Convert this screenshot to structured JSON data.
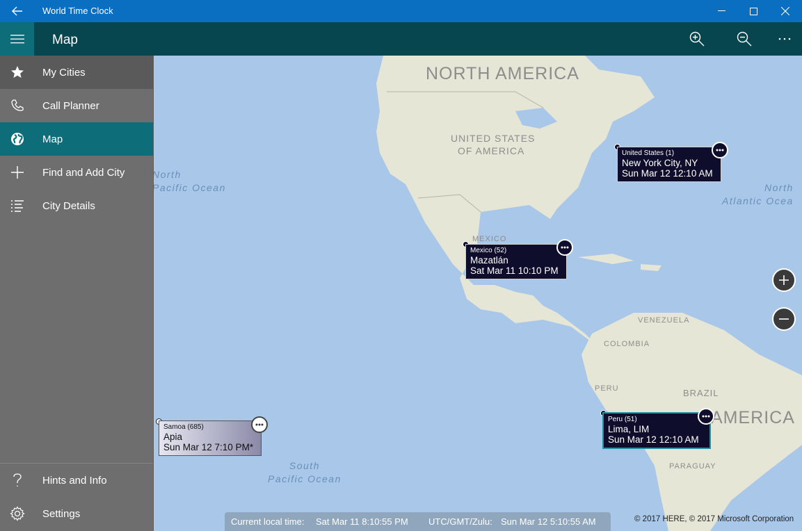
{
  "window": {
    "title": "World Time Clock"
  },
  "appbar": {
    "page_title": "Map"
  },
  "nav": {
    "items": [
      {
        "label": "My Cities",
        "icon": "star-icon"
      },
      {
        "label": "Call Planner",
        "icon": "phone-icon"
      },
      {
        "label": "Map",
        "icon": "globe-icon"
      },
      {
        "label": "Find and Add City",
        "icon": "plus-icon"
      },
      {
        "label": "City Details",
        "icon": "list-icon"
      }
    ],
    "bottom": [
      {
        "label": "Hints and Info",
        "icon": "question-icon"
      },
      {
        "label": "Settings",
        "icon": "gear-icon"
      }
    ],
    "selected": "Map"
  },
  "map": {
    "continents": [
      "NORTH AMERICA",
      "AMERICA"
    ],
    "countries": [
      "UNITED STATES",
      "OF AMERICA",
      "MEXICO",
      "VENEZUELA",
      "COLOMBIA",
      "PERU",
      "BRAZIL",
      "PARAGUAY"
    ],
    "oceans": {
      "north_pacific": [
        "North",
        "Pacific Ocean"
      ],
      "north_atlantic": [
        "North",
        "Atlantic Ocea"
      ],
      "south_pacific": [
        "South",
        "Pacific Ocean"
      ]
    },
    "callouts": [
      {
        "country": "United States (1)",
        "city": "New York City, NY",
        "time": "Sun Mar 12  12:10 AM"
      },
      {
        "country": "Mexico (52)",
        "city": "Mazatlán",
        "time": "Sat Mar 11  10:10 PM"
      },
      {
        "country": "Samoa (685)",
        "city": "Apia",
        "time": "Sun Mar 12  7:10 PM*"
      },
      {
        "country": "Peru (51)",
        "city": "Lima, LIM",
        "time": "Sun Mar 12  12:10 AM"
      }
    ]
  },
  "status": {
    "local_label": "Current local time:",
    "local_value": "Sat Mar 11  8:10:55 PM",
    "utc_label": "UTC/GMT/Zulu:",
    "utc_value": "Sun Mar 12  5:10:55 AM"
  },
  "copyright": "© 2017 HERE, © 2017 Microsoft Corporation",
  "colors": {
    "titlebar": "#0b6fc1",
    "appbar": "#07454f",
    "accent": "#0d6e7a",
    "sidebar": "#6e6e6e",
    "ocean": "#a9c7e8",
    "land": "#e6e6d6"
  }
}
